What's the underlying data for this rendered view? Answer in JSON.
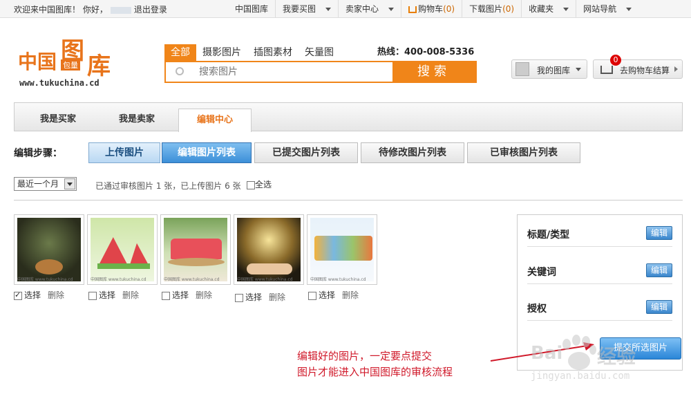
{
  "topbar": {
    "welcome": "欢迎来中国图库！ 你好，",
    "logout": "退出登录",
    "nav": [
      {
        "label": "中国图库",
        "caret": false
      },
      {
        "label": "我要买图",
        "caret": true
      },
      {
        "label": "卖家中心",
        "caret": true
      },
      {
        "label": "购物车",
        "count": "(0)",
        "caret": false
      },
      {
        "label": "下载图片",
        "count": "(0)",
        "caret": false
      },
      {
        "label": "收藏夹",
        "caret": true
      },
      {
        "label": "网站导航",
        "caret": true
      }
    ]
  },
  "logo": {
    "zhongguo": "中国",
    "tu": "图",
    "ku": "库",
    "baoliang": "包量",
    "url": "www.tukuchina.cd"
  },
  "search": {
    "tabs": [
      "全部",
      "摄影图片",
      "插图素材",
      "矢量图"
    ],
    "active_tab": 0,
    "hotline": "热线：400-008-5336",
    "placeholder": "搜索图片",
    "button": "搜索"
  },
  "account": {
    "my_library": "我的图库",
    "cart_badge": "0",
    "go_cart": "去购物车结算"
  },
  "role_tabs": {
    "buyer": "我是买家",
    "seller": "我是卖家",
    "editor": "编辑中心"
  },
  "steps": {
    "label": "编辑步骤：",
    "items": [
      "上传图片",
      "编辑图片列表",
      "已提交图片列表",
      "待修改图片列表",
      "已审核图片列表"
    ]
  },
  "filter": {
    "period": "最近一个月",
    "stats": "已通过审核图片 1 张，已上传图片 6 张",
    "select_all": "全选"
  },
  "thumbnails": {
    "select": "选择",
    "delete": "删除",
    "watermark": "中国图库 www.tukuchina.cd",
    "items": [
      {
        "checked": true
      },
      {
        "checked": false
      },
      {
        "checked": false
      },
      {
        "checked": false
      },
      {
        "checked": false
      }
    ]
  },
  "panel": {
    "rows": [
      {
        "label": "标题/类型",
        "button": "编辑"
      },
      {
        "label": "关键词",
        "button": "编辑"
      },
      {
        "label": "授权",
        "button": "编辑"
      }
    ],
    "submit": "提交所选图片"
  },
  "annotation": {
    "line1": "编辑好的图片，一定要点提交",
    "line2": "图片才能进入中国图库的审核流程"
  },
  "watermark": {
    "bai": "Bai",
    "jingyan": "经验",
    "url": "jingyan.baidu.com"
  },
  "colors": {
    "brand_orange": "#f08519",
    "step_active": "#3c8fd8",
    "annotation_red": "#d0192a"
  }
}
